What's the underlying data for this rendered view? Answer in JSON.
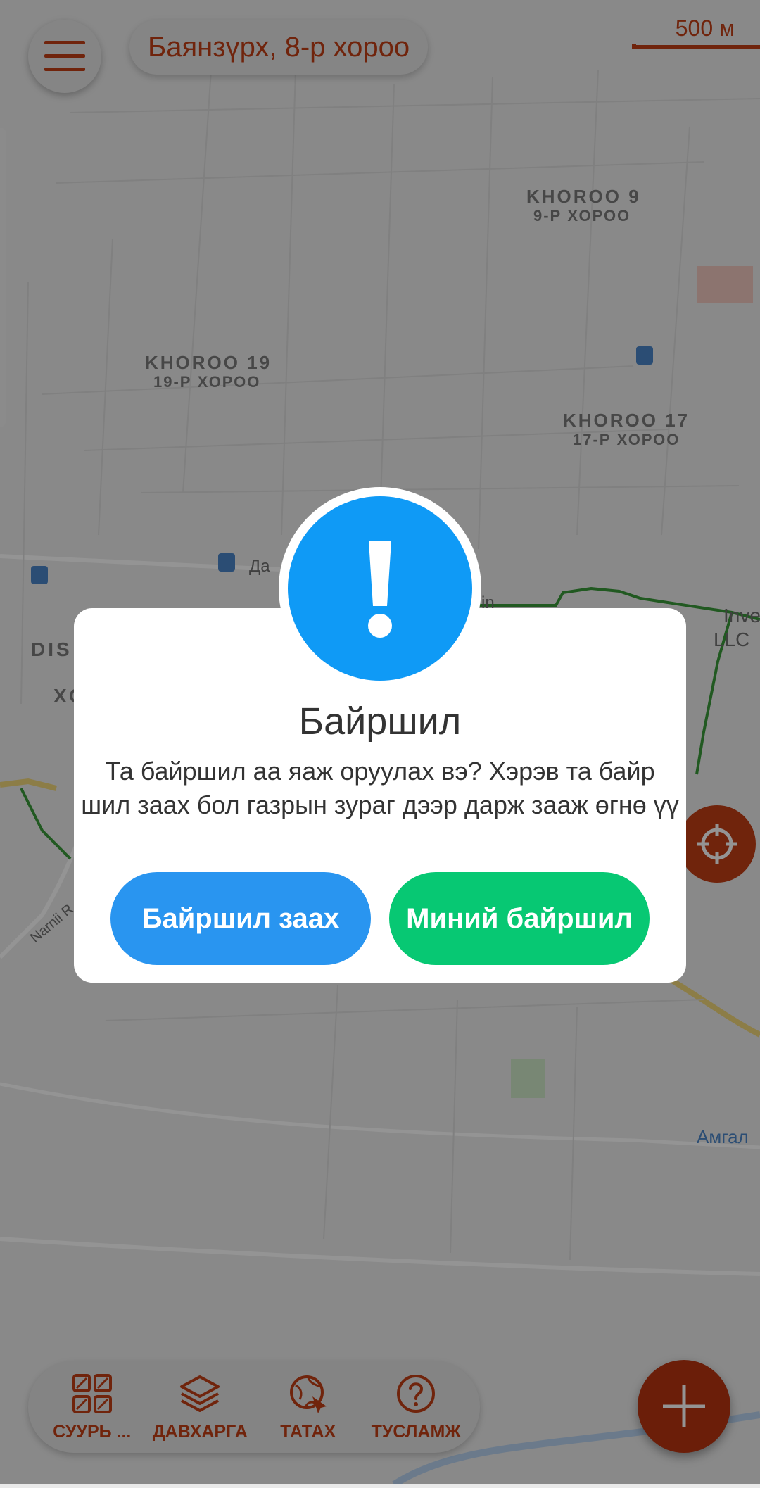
{
  "header": {
    "location_label": "Баянзүрх, 8-р хороо",
    "scale_label": "500 м"
  },
  "map": {
    "labels": [
      {
        "text": "KHOROO 9"
      },
      {
        "text": "9-Р ХОРОО"
      },
      {
        "text": "KHOROO 19"
      },
      {
        "text": "19-Р ХОРОО"
      },
      {
        "text": "KHOROO 17"
      },
      {
        "text": "17-Р ХОРОО"
      },
      {
        "text": "DIS"
      },
      {
        "text": "ХО"
      },
      {
        "text": "Да"
      },
      {
        "text": "in"
      },
      {
        "text": "Inve"
      },
      {
        "text": "LLC"
      },
      {
        "text": "Narnii R"
      },
      {
        "text": "Амгал"
      }
    ]
  },
  "dialog": {
    "title": "Байршил",
    "message": "Та байршил аа яаж оруулах вэ? Хэрэв та байр шил заах бол газрын зураг дээр дарж зааж өгнө үү",
    "btn_select": "Байршил заах",
    "btn_mine": "Миний байршил"
  },
  "toolbar": {
    "items": [
      {
        "label": "СУУРЬ ...",
        "icon": "base-map-icon"
      },
      {
        "label": "ДАВХАРГА",
        "icon": "layers-icon"
      },
      {
        "label": "ТАТАХ",
        "icon": "download-map-icon"
      },
      {
        "label": "ТУСЛАМЖ",
        "icon": "help-icon"
      }
    ]
  },
  "colors": {
    "accent": "#c23e15",
    "alert_blue": "#0f9af6",
    "button_blue": "#2995f0",
    "button_green": "#07c873"
  }
}
